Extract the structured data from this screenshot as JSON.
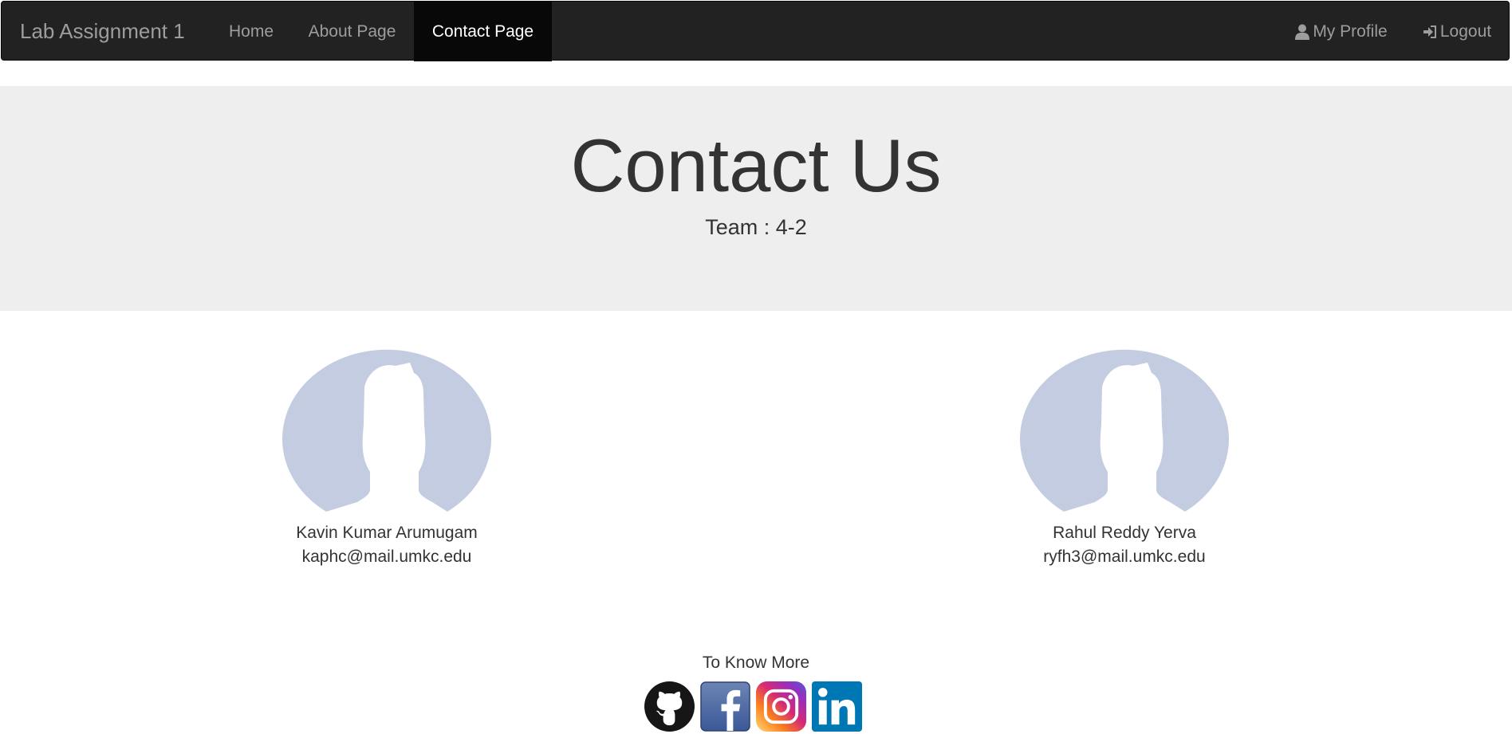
{
  "navbar": {
    "brand": "Lab Assignment 1",
    "links": [
      {
        "label": "Home"
      },
      {
        "label": "About Page"
      },
      {
        "label": "Contact Page",
        "active": true
      }
    ],
    "right": [
      {
        "label": "My Profile",
        "icon": "user-icon"
      },
      {
        "label": "Logout",
        "icon": "log-in-icon"
      }
    ]
  },
  "jumbotron": {
    "title": "Contact Us",
    "subtitle": "Team : 4-2"
  },
  "members": [
    {
      "name": "Kavin Kumar Arumugam",
      "email": "kaphc@mail.umkc.edu",
      "icon": "avatar-placeholder-icon"
    },
    {
      "name": "Rahul Reddy Yerva",
      "email": "ryfh3@mail.umkc.edu",
      "icon": "avatar-placeholder-icon"
    }
  ],
  "footer": {
    "title": "To Know More",
    "social": [
      "github-icon",
      "facebook-icon",
      "instagram-icon",
      "linkedin-icon"
    ]
  },
  "colors": {
    "navbar_bg": "#222222",
    "navbar_active_bg": "#080808",
    "navbar_text": "#9d9d9d",
    "jumbotron_bg": "#eeeeee",
    "avatar_fill": "#c3cce0",
    "facebook_blue": "#3b5998",
    "linkedin_blue": "#0077b5"
  }
}
